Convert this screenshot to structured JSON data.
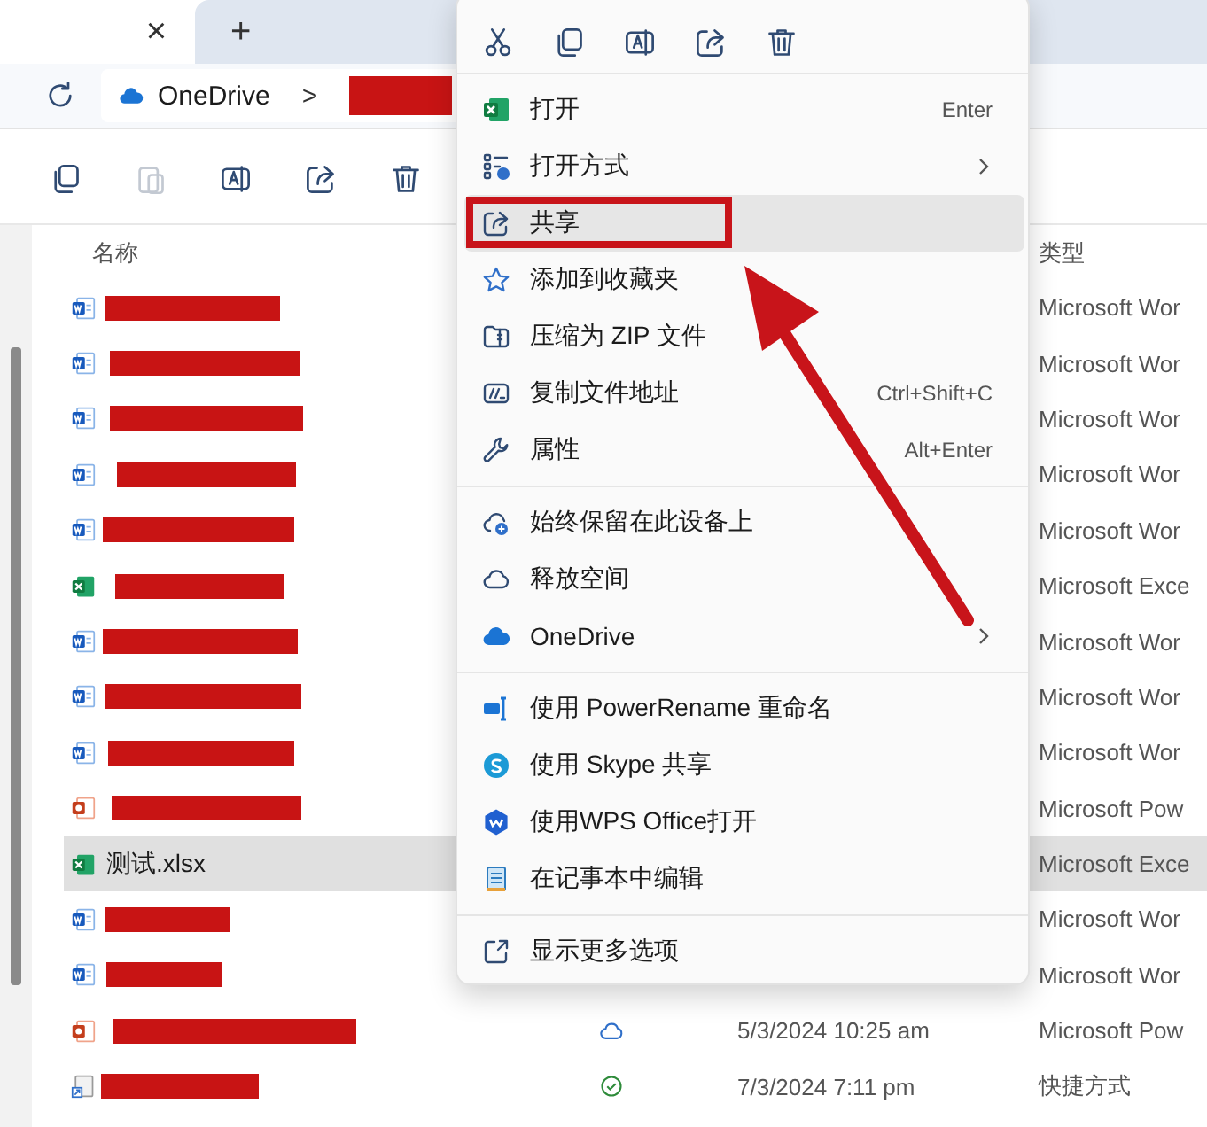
{
  "tabs": {
    "close": "×",
    "new_tab": "+"
  },
  "address_bar": {
    "location": "OneDrive",
    "separator": ">",
    "path_redacted": true
  },
  "toolbar": [
    {
      "disabled": false
    },
    {
      "disabled": true
    },
    {
      "disabled": false
    },
    {
      "disabled": false
    },
    {
      "disabled": false
    }
  ],
  "file_list": {
    "columns": [
      "名称",
      "类型"
    ],
    "rows": [
      {
        "kind": "word",
        "redacted": true,
        "selected": false,
        "type": "Microsoft Wor"
      },
      {
        "kind": "word",
        "redacted": true,
        "selected": false,
        "type": "Microsoft Wor"
      },
      {
        "kind": "word",
        "redacted": true,
        "selected": false,
        "type": "Microsoft Wor"
      },
      {
        "kind": "word",
        "redacted": true,
        "selected": false,
        "type": "Microsoft Wor"
      },
      {
        "kind": "word",
        "redacted": true,
        "selected": false,
        "type": "Microsoft Wor"
      },
      {
        "kind": "excel",
        "redacted": true,
        "selected": false,
        "type": "Microsoft Exce"
      },
      {
        "kind": "word",
        "redacted": true,
        "selected": false,
        "type": "Microsoft Wor"
      },
      {
        "kind": "word",
        "redacted": true,
        "selected": false,
        "type": "Microsoft Wor"
      },
      {
        "kind": "word",
        "redacted": true,
        "selected": false,
        "type": "Microsoft Wor"
      },
      {
        "kind": "powerpoint",
        "redacted": true,
        "selected": false,
        "type": "Microsoft Pow"
      },
      {
        "kind": "excel",
        "redacted": false,
        "name": "测试.xlsx",
        "selected": true,
        "type": "Microsoft Exce"
      },
      {
        "kind": "word",
        "redacted": true,
        "selected": false,
        "type": "Microsoft Wor"
      },
      {
        "kind": "word",
        "redacted": true,
        "selected": false,
        "type": "Microsoft Wor"
      },
      {
        "kind": "powerpoint",
        "redacted": true,
        "selected": false,
        "synced": false,
        "date": "5/3/2024 10:25 am",
        "type": "Microsoft Pow"
      },
      {
        "kind": "shortcut",
        "redacted": true,
        "selected": false,
        "synced": true,
        "date": "7/3/2024 7:11 pm",
        "type": "快捷方式"
      }
    ]
  },
  "context_menu": {
    "groups": [
      [
        {
          "label": "打开",
          "shortcut": "Enter",
          "submenu": false,
          "hovered": false
        },
        {
          "label": "打开方式",
          "submenu": true,
          "hovered": false
        },
        {
          "label": "共享",
          "submenu": false,
          "hovered": true
        },
        {
          "label": "添加到收藏夹",
          "submenu": false,
          "hovered": false
        },
        {
          "label": "压缩为 ZIP 文件",
          "submenu": false,
          "hovered": false
        },
        {
          "label": "复制文件地址",
          "shortcut": "Ctrl+Shift+C",
          "submenu": false,
          "hovered": false
        },
        {
          "label": "属性",
          "shortcut": "Alt+Enter",
          "submenu": false,
          "hovered": false
        }
      ],
      [
        {
          "label": "始终保留在此设备上",
          "submenu": false,
          "hovered": false
        },
        {
          "label": "释放空间",
          "submenu": false,
          "hovered": false
        },
        {
          "label": "OneDrive",
          "submenu": true,
          "hovered": false
        }
      ],
      [
        {
          "label": "使用 PowerRename 重命名",
          "submenu": false,
          "hovered": false
        },
        {
          "label": "使用 Skype 共享",
          "submenu": false,
          "hovered": false
        },
        {
          "label": "使用WPS Office打开",
          "submenu": false,
          "hovered": false
        },
        {
          "label": "在记事本中编辑",
          "submenu": false,
          "hovered": false
        }
      ],
      [
        {
          "label": "显示更多选项",
          "submenu": false,
          "hovered": false
        }
      ]
    ]
  },
  "annotations": {
    "highlight_frame": true,
    "arrow": true
  }
}
